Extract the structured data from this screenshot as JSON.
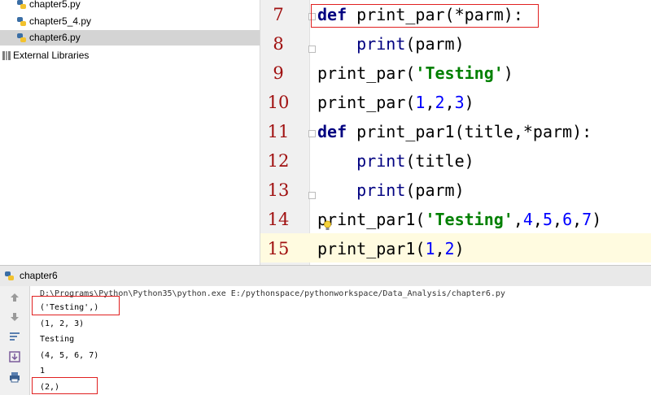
{
  "project_tree": {
    "items": [
      {
        "label": "chapter5.py"
      },
      {
        "label": "chapter5_4.py"
      },
      {
        "label": "chapter6.py"
      }
    ],
    "external_libraries": "External Libraries"
  },
  "editor": {
    "line_numbers": [
      "7",
      "8",
      "9",
      "10",
      "11",
      "12",
      "13",
      "14",
      "15"
    ],
    "lines": [
      [
        {
          "t": "def",
          "c": "kw"
        },
        {
          "t": " print_par(*parm):",
          "c": ""
        }
      ],
      [
        {
          "t": "    ",
          "c": ""
        },
        {
          "t": "print",
          "c": "fn"
        },
        {
          "t": "(parm)",
          "c": ""
        }
      ],
      [
        {
          "t": "print_par(",
          "c": ""
        },
        {
          "t": "'Testing'",
          "c": "str"
        },
        {
          "t": ")",
          "c": ""
        }
      ],
      [
        {
          "t": "print_par(",
          "c": ""
        },
        {
          "t": "1",
          "c": "num"
        },
        {
          "t": ",",
          "c": ""
        },
        {
          "t": "2",
          "c": "num"
        },
        {
          "t": ",",
          "c": ""
        },
        {
          "t": "3",
          "c": "num"
        },
        {
          "t": ")",
          "c": ""
        }
      ],
      [
        {
          "t": "def",
          "c": "kw"
        },
        {
          "t": " print_par1(title,*parm):",
          "c": ""
        }
      ],
      [
        {
          "t": "    ",
          "c": ""
        },
        {
          "t": "print",
          "c": "fn"
        },
        {
          "t": "(title)",
          "c": ""
        }
      ],
      [
        {
          "t": "    ",
          "c": ""
        },
        {
          "t": "print",
          "c": "fn"
        },
        {
          "t": "(parm)",
          "c": ""
        }
      ],
      [
        {
          "t": "print_par1(",
          "c": ""
        },
        {
          "t": "'Testing'",
          "c": "str"
        },
        {
          "t": ",",
          "c": ""
        },
        {
          "t": "4",
          "c": "num"
        },
        {
          "t": ",",
          "c": ""
        },
        {
          "t": "5",
          "c": "num"
        },
        {
          "t": ",",
          "c": ""
        },
        {
          "t": "6",
          "c": "num"
        },
        {
          "t": ",",
          "c": ""
        },
        {
          "t": "7",
          "c": "num"
        },
        {
          "t": ")",
          "c": ""
        }
      ],
      [
        {
          "t": "print_par1(",
          "c": ""
        },
        {
          "t": "1",
          "c": "num"
        },
        {
          "t": ",",
          "c": ""
        },
        {
          "t": "2",
          "c": "num"
        },
        {
          "t": ")",
          "c": ""
        }
      ]
    ]
  },
  "run_panel": {
    "title": "chapter6",
    "command": "D:\\Programs\\Python\\Python35\\python.exe E:/pythonspace/pythonworkspace/Data_Analysis/chapter6.py",
    "output": [
      "('Testing',)",
      "(1, 2, 3)",
      "Testing",
      "(4, 5, 6, 7)",
      "1",
      "(2,)"
    ]
  },
  "colors": {
    "keyword": "#000080",
    "string": "#008000",
    "number": "#0000ff",
    "line_number": "#a01010",
    "highlight_box": "#e02020"
  }
}
